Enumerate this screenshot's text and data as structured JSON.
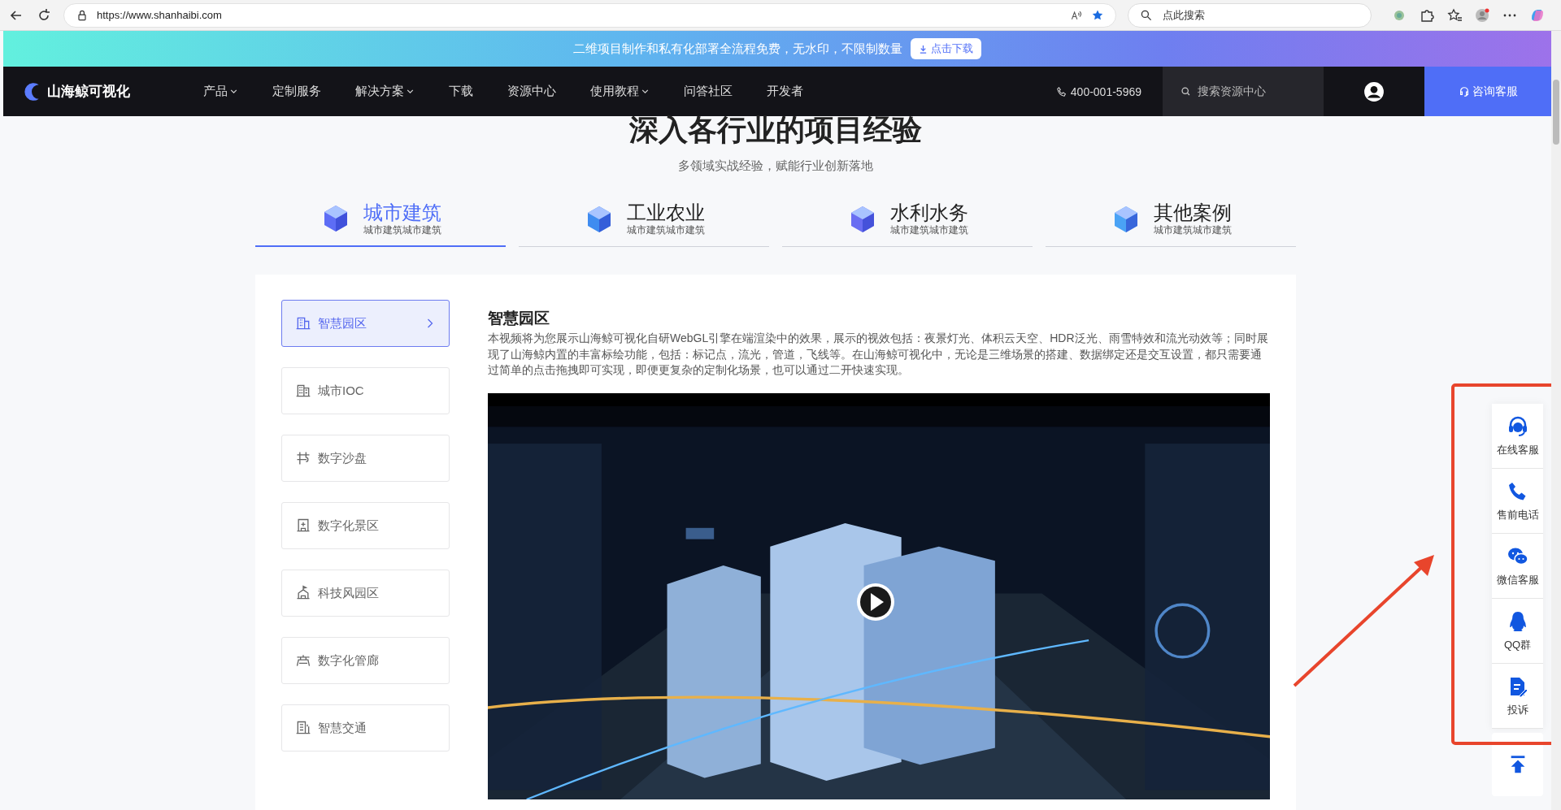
{
  "browser": {
    "url": "https://www.shanhaibi.com",
    "search_placeholder": "点此搜索"
  },
  "promo": {
    "text": "二维项目制作和私有化部署全流程免费，无水印，不限制数量",
    "button": "点击下载"
  },
  "nav": {
    "logo": "山海鲸可视化",
    "items": [
      {
        "label": "产品",
        "dropdown": true
      },
      {
        "label": "定制服务",
        "dropdown": false
      },
      {
        "label": "解决方案",
        "dropdown": true
      },
      {
        "label": "下载",
        "dropdown": false
      },
      {
        "label": "资源中心",
        "dropdown": false
      },
      {
        "label": "使用教程",
        "dropdown": true
      },
      {
        "label": "问答社区",
        "dropdown": false
      },
      {
        "label": "开发者",
        "dropdown": false
      }
    ],
    "phone": "400-001-5969",
    "search_placeholder": "搜索资源中心",
    "consult": "咨询客服"
  },
  "section": {
    "title": "深入各行业的项目经验",
    "subtitle": "多领域实战经验，赋能行业创新落地"
  },
  "tabs": [
    {
      "title": "城市建筑",
      "subtitle": "城市建筑城市建筑",
      "selected": true
    },
    {
      "title": "工业农业",
      "subtitle": "城市建筑城市建筑",
      "selected": false
    },
    {
      "title": "水利水务",
      "subtitle": "城市建筑城市建筑",
      "selected": false
    },
    {
      "title": "其他案例",
      "subtitle": "城市建筑城市建筑",
      "selected": false
    }
  ],
  "menu": [
    {
      "label": "智慧园区",
      "selected": true
    },
    {
      "label": "城市IOC",
      "selected": false
    },
    {
      "label": "数字沙盘",
      "selected": false
    },
    {
      "label": "数字化景区",
      "selected": false
    },
    {
      "label": "科技风园区",
      "selected": false
    },
    {
      "label": "数字化管廊",
      "selected": false
    },
    {
      "label": "智慧交通",
      "selected": false
    }
  ],
  "detail": {
    "title": "智慧园区",
    "text": "本视频将为您展示山海鲸可视化自研WebGL引擎在端渲染中的效果，展示的视效包括：夜景灯光、体积云天空、HDR泛光、雨雪特效和流光动效等；同时展现了山海鲸内置的丰富标绘功能，包括：标记点，流光，管道，飞线等。在山海鲸可视化中，无论是三维场景的搭建、数据绑定还是交互设置，都只需要通过简单的点击拖拽即可实现，即便更复杂的定制化场景，也可以通过二开快速实现。"
  },
  "float_tools": [
    {
      "label": "在线客服"
    },
    {
      "label": "售前电话"
    },
    {
      "label": "微信客服"
    },
    {
      "label": "QQ群"
    },
    {
      "label": "投诉"
    }
  ]
}
